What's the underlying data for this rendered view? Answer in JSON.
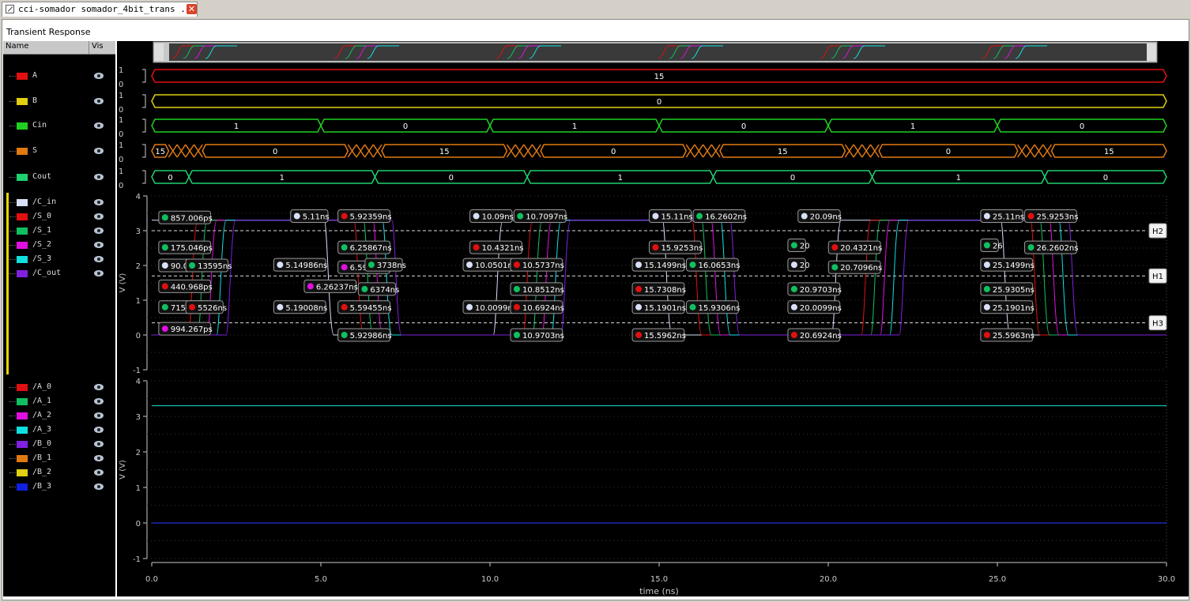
{
  "tab": {
    "title": "cci-somador somador_4bit_trans ...",
    "close": "✕"
  },
  "panel_title": "Transient Response",
  "columns": {
    "name": "Name",
    "vis": "Vis"
  },
  "digital_signals": [
    {
      "name": "A",
      "color": "#e01010",
      "segments": [
        {
          "from": 0,
          "to": 30,
          "value": "15"
        }
      ]
    },
    {
      "name": "B",
      "color": "#e0d010",
      "segments": [
        {
          "from": 0,
          "to": 30,
          "value": "0"
        }
      ]
    },
    {
      "name": "Cin",
      "color": "#20d020",
      "segments": [
        {
          "from": 0,
          "to": 5,
          "value": "1"
        },
        {
          "from": 5,
          "to": 10,
          "value": "0"
        },
        {
          "from": 10,
          "to": 15,
          "value": "1"
        },
        {
          "from": 15,
          "to": 20,
          "value": "0"
        },
        {
          "from": 20,
          "to": 25,
          "value": "1"
        },
        {
          "from": 25,
          "to": 30,
          "value": "0"
        }
      ]
    },
    {
      "name": "S",
      "color": "#e07a10",
      "segments": [
        {
          "from": 0,
          "to": 0.5,
          "value": "15"
        },
        {
          "from": 1.5,
          "to": 5.8,
          "value": "0"
        },
        {
          "from": 6.8,
          "to": 10.5,
          "value": "15"
        },
        {
          "from": 11.5,
          "to": 15.8,
          "value": "0"
        },
        {
          "from": 16.8,
          "to": 20.5,
          "value": "15"
        },
        {
          "from": 21.5,
          "to": 25.6,
          "value": "0"
        },
        {
          "from": 26.6,
          "to": 30,
          "value": "15"
        }
      ],
      "busy": [
        [
          0.5,
          1.5
        ],
        [
          5.8,
          6.8
        ],
        [
          10.5,
          11.5
        ],
        [
          15.8,
          16.8
        ],
        [
          20.5,
          21.5
        ],
        [
          25.6,
          26.6
        ]
      ]
    },
    {
      "name": "Cout",
      "color": "#20d070",
      "segments": [
        {
          "from": 0,
          "to": 1.1,
          "value": "0"
        },
        {
          "from": 1.1,
          "to": 6.6,
          "value": "1"
        },
        {
          "from": 6.6,
          "to": 11.1,
          "value": "0"
        },
        {
          "from": 11.1,
          "to": 16.6,
          "value": "1"
        },
        {
          "from": 16.6,
          "to": 21.3,
          "value": "0"
        },
        {
          "from": 21.3,
          "to": 26.4,
          "value": "1"
        },
        {
          "from": 26.4,
          "to": 30,
          "value": "0"
        }
      ]
    }
  ],
  "digital_levels": {
    "high": "1",
    "low": "0"
  },
  "analog_group1": [
    {
      "name": "/C_in",
      "color": "#d8e0f8"
    },
    {
      "name": "/S_0",
      "color": "#e01010"
    },
    {
      "name": "/S_1",
      "color": "#10c060"
    },
    {
      "name": "/S_2",
      "color": "#e010e0"
    },
    {
      "name": "/S_3",
      "color": "#10e0e0"
    },
    {
      "name": "/C_out",
      "color": "#8020e0"
    }
  ],
  "analog_group2": [
    {
      "name": "/A_0",
      "color": "#e01010"
    },
    {
      "name": "/A_1",
      "color": "#10c060"
    },
    {
      "name": "/A_2",
      "color": "#e010e0"
    },
    {
      "name": "/A_3",
      "color": "#10e0e0"
    },
    {
      "name": "/B_0",
      "color": "#8020e0"
    },
    {
      "name": "/B_1",
      "color": "#e07a10"
    },
    {
      "name": "/B_2",
      "color": "#e0d010"
    },
    {
      "name": "/B_3",
      "color": "#1020e0"
    }
  ],
  "axes": {
    "x_label": "time (ns)",
    "x_ticks": [
      "0.0",
      "5.0",
      "10.0",
      "15.0",
      "20.0",
      "25.0",
      "30.0"
    ],
    "x_range": [
      0,
      30
    ],
    "y_label": "V (V)",
    "y_ticks": [
      "4",
      "3",
      "2",
      "1",
      "0",
      "-1"
    ],
    "y_range": [
      -1,
      4
    ]
  },
  "cursors": [
    {
      "label": "H2",
      "v": 3.0
    },
    {
      "label": "H1",
      "v": 1.7
    },
    {
      "label": "H3",
      "v": 0.35
    }
  ],
  "group2_levels": [
    {
      "v": 3.3,
      "color": "#10c0b0"
    },
    {
      "v": 0.0,
      "color": "#2030e0"
    }
  ],
  "markers": [
    {
      "t": 0.3,
      "v": 3.38,
      "label": "857.006ps",
      "color": "#10c060"
    },
    {
      "t": 0.3,
      "v": 2.52,
      "label": "175.046ps",
      "color": "#10c060"
    },
    {
      "t": 0.3,
      "v": 2.0,
      "label": "90.0ps",
      "color": "#d8e0f8"
    },
    {
      "t": 1.1,
      "v": 2.0,
      "label": "13595ns",
      "color": "#10c060"
    },
    {
      "t": 0.3,
      "v": 1.4,
      "label": "440.968ps",
      "color": "#e01010"
    },
    {
      "t": 0.3,
      "v": 0.8,
      "label": "715.429ps",
      "color": "#10c060"
    },
    {
      "t": 1.1,
      "v": 0.8,
      "label": "5526ns",
      "color": "#e01010"
    },
    {
      "t": 0.3,
      "v": 0.18,
      "label": "994.267ps",
      "color": "#e010e0"
    },
    {
      "t": 4.2,
      "v": 3.42,
      "label": "5.11ns",
      "color": "#d8e0f8"
    },
    {
      "t": 3.7,
      "v": 2.02,
      "label": "5.14986ns",
      "color": "#d8e0f8"
    },
    {
      "t": 3.7,
      "v": 0.8,
      "label": "5.19008ns",
      "color": "#d8e0f8"
    },
    {
      "t": 4.6,
      "v": 1.4,
      "label": "6.26237ns",
      "color": "#e010e0"
    },
    {
      "t": 5.6,
      "v": 3.42,
      "label": "5.92359ns",
      "color": "#e01010"
    },
    {
      "t": 5.6,
      "v": 2.52,
      "label": "6.25867ns",
      "color": "#10c060"
    },
    {
      "t": 5.6,
      "v": 1.95,
      "label": "6.59253ns",
      "color": "#e010e0"
    },
    {
      "t": 6.4,
      "v": 2.02,
      "label": "3738ns",
      "color": "#10c060"
    },
    {
      "t": 6.2,
      "v": 1.32,
      "label": "6374ns",
      "color": "#10c060"
    },
    {
      "t": 5.6,
      "v": 0.8,
      "label": "5.59455ns",
      "color": "#e01010"
    },
    {
      "t": 5.6,
      "v": 0.0,
      "label": "5.92986ns",
      "color": "#10c060"
    },
    {
      "t": 9.5,
      "v": 3.42,
      "label": "10.09ns",
      "color": "#d8e0f8"
    },
    {
      "t": 9.3,
      "v": 2.02,
      "label": "10.0501ns",
      "color": "#d8e0f8"
    },
    {
      "t": 9.3,
      "v": 0.8,
      "label": "10.0099ns",
      "color": "#d8e0f8"
    },
    {
      "t": 9.5,
      "v": 2.52,
      "label": "10.4321ns",
      "color": "#e01010"
    },
    {
      "t": 10.8,
      "v": 3.42,
      "label": "10.7097ns",
      "color": "#10c060"
    },
    {
      "t": 10.7,
      "v": 2.02,
      "label": "10.5737ns",
      "color": "#e01010"
    },
    {
      "t": 10.7,
      "v": 1.32,
      "label": "10.8512ns",
      "color": "#10c060"
    },
    {
      "t": 10.7,
      "v": 0.8,
      "label": "10.6924ns",
      "color": "#e01010"
    },
    {
      "t": 10.7,
      "v": 0.0,
      "label": "10.9703ns",
      "color": "#10c060"
    },
    {
      "t": 14.8,
      "v": 3.42,
      "label": "15.11ns",
      "color": "#d8e0f8"
    },
    {
      "t": 14.3,
      "v": 2.02,
      "label": "15.1499ns",
      "color": "#d8e0f8"
    },
    {
      "t": 14.3,
      "v": 0.8,
      "label": "15.1901ns",
      "color": "#d8e0f8"
    },
    {
      "t": 14.8,
      "v": 2.52,
      "label": "15.9253ns",
      "color": "#e01010"
    },
    {
      "t": 14.3,
      "v": 1.32,
      "label": "15.7308ns",
      "color": "#e01010"
    },
    {
      "t": 14.3,
      "v": 0.0,
      "label": "15.5962ns",
      "color": "#e01010"
    },
    {
      "t": 16.1,
      "v": 3.42,
      "label": "16.2602ns",
      "color": "#10c060"
    },
    {
      "t": 15.9,
      "v": 2.02,
      "label": "16.0653ns",
      "color": "#10c060"
    },
    {
      "t": 15.9,
      "v": 0.8,
      "label": "15.9306ns",
      "color": "#10c060"
    },
    {
      "t": 19.2,
      "v": 3.42,
      "label": "20.09ns",
      "color": "#d8e0f8"
    },
    {
      "t": 18.9,
      "v": 2.58,
      "label": "20",
      "color": "#10c060"
    },
    {
      "t": 20.1,
      "v": 2.52,
      "label": "20.4321ns",
      "color": "#e01010"
    },
    {
      "t": 18.9,
      "v": 2.02,
      "label": "20",
      "color": "#d8e0f8"
    },
    {
      "t": 20.1,
      "v": 1.95,
      "label": "20.7096ns",
      "color": "#10c060"
    },
    {
      "t": 18.9,
      "v": 1.32,
      "label": "20.9703ns",
      "color": "#10c060"
    },
    {
      "t": 18.9,
      "v": 0.8,
      "label": "20.0099ns",
      "color": "#d8e0f8"
    },
    {
      "t": 18.9,
      "v": 0.0,
      "label": "20.6924ns",
      "color": "#e01010"
    },
    {
      "t": 24.6,
      "v": 3.42,
      "label": "25.11ns",
      "color": "#d8e0f8"
    },
    {
      "t": 25.9,
      "v": 3.42,
      "label": "25.9253ns",
      "color": "#e01010"
    },
    {
      "t": 24.6,
      "v": 2.58,
      "label": "26",
      "color": "#10c060"
    },
    {
      "t": 25.9,
      "v": 2.52,
      "label": "26.2602ns",
      "color": "#10c060"
    },
    {
      "t": 24.6,
      "v": 2.02,
      "label": "25.1499ns",
      "color": "#d8e0f8"
    },
    {
      "t": 24.6,
      "v": 1.32,
      "label": "25.9305ns",
      "color": "#10c060"
    },
    {
      "t": 24.6,
      "v": 0.8,
      "label": "25.1901ns",
      "color": "#d8e0f8"
    },
    {
      "t": 24.6,
      "v": 0.0,
      "label": "25.5963ns",
      "color": "#e01010"
    }
  ]
}
